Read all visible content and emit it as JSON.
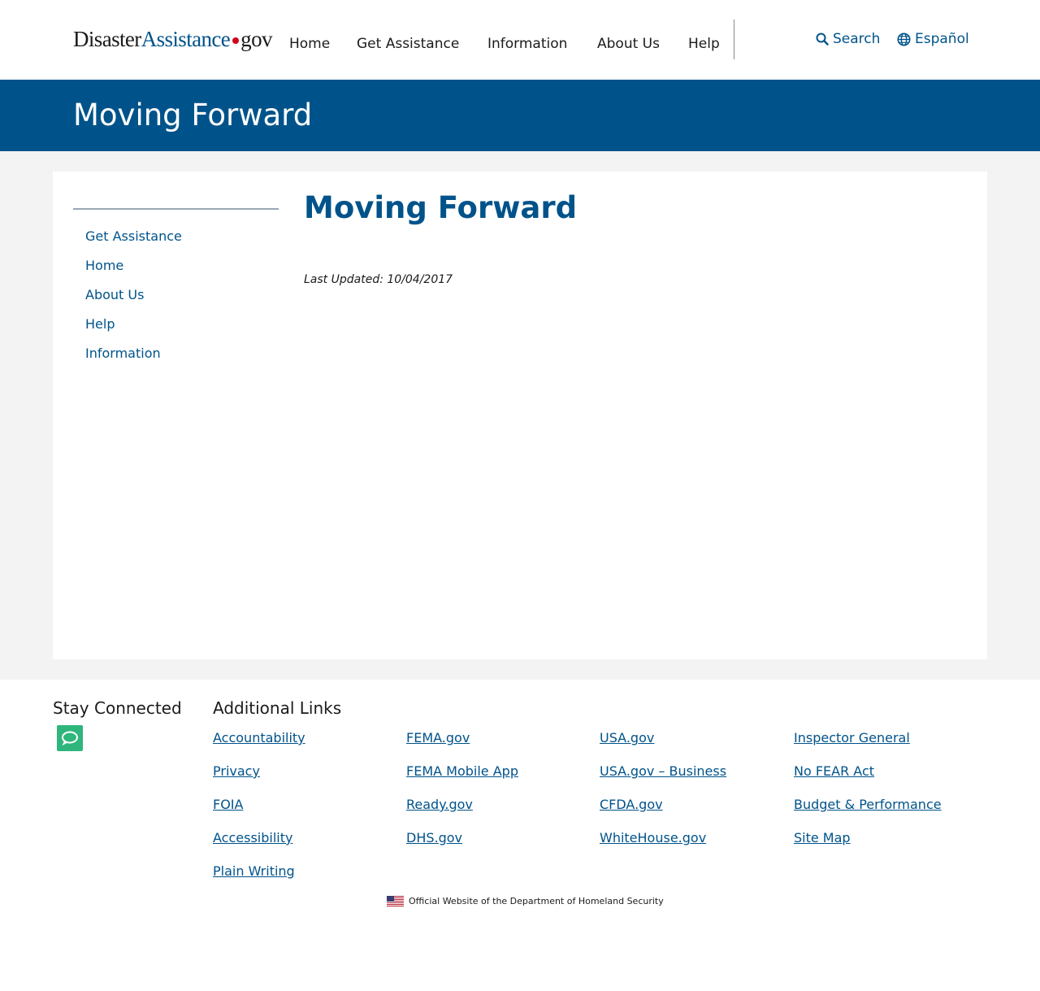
{
  "header": {
    "logo": {
      "part1": "Disaster",
      "part2": "Assistance",
      "part3": "gov"
    },
    "nav": [
      {
        "label": "Home"
      },
      {
        "label": "Get Assistance"
      },
      {
        "label": "Information"
      },
      {
        "label": "About Us"
      },
      {
        "label": "Help"
      }
    ],
    "search_label": "Search",
    "language_label": "Español"
  },
  "banner": {
    "title": "Moving Forward"
  },
  "sidebar": {
    "items": [
      {
        "label": "Get Assistance"
      },
      {
        "label": "Home"
      },
      {
        "label": "About Us"
      },
      {
        "label": "Help"
      },
      {
        "label": "Information"
      }
    ]
  },
  "content": {
    "title": "Moving Forward",
    "last_updated": "Last Updated: 10/04/2017"
  },
  "footer": {
    "stay_connected": "Stay Connected",
    "additional_links_title": "Additional Links",
    "columns": [
      [
        "Accountability",
        "Privacy",
        "FOIA",
        "Accessibility",
        "Plain Writing"
      ],
      [
        "FEMA.gov",
        "FEMA Mobile App",
        "Ready.gov",
        "DHS.gov"
      ],
      [
        "USA.gov",
        "USA.gov – Business",
        "CFDA.gov",
        "WhiteHouse.gov"
      ],
      [
        "Inspector General",
        "No FEAR Act",
        "Budget & Performance",
        "Site Map"
      ]
    ],
    "official_text": "Official Website of the Department of Homeland Security"
  },
  "colors": {
    "brand_blue": "#00538a",
    "chat_green": "#2fb67c",
    "logo_dot_red": "#d0021b"
  },
  "icons": {
    "search": "search-icon",
    "language": "globe-icon",
    "chat": "chat-bubble-icon",
    "flag": "us-flag-icon"
  }
}
